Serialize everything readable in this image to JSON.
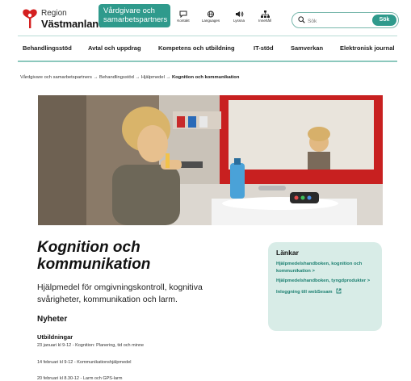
{
  "header": {
    "logo_region": "Region",
    "logo_name": "Västmanland",
    "partner_tag": "Vårdgivare och samarbetspartners",
    "icons": [
      {
        "name": "contact-icon",
        "label": "Kontakt"
      },
      {
        "name": "languages-icon",
        "label": "Languages"
      },
      {
        "name": "listen-icon",
        "label": "Lyssna"
      },
      {
        "name": "sitemap-icon",
        "label": "Innehåll"
      }
    ],
    "search": {
      "placeholder": "Sök",
      "button": "Sök"
    },
    "brand_color": "#2f9a8c"
  },
  "nav": {
    "items": [
      "Behandlingsstöd",
      "Avtal och uppdrag",
      "Kompetens och utbildning",
      "IT-stöd",
      "Samverkan",
      "Elektronisk journal"
    ]
  },
  "breadcrumb": {
    "items": [
      "Vårdgivare och samarbetspartners",
      "Behandlingsstöd",
      "Hjälpmedel"
    ],
    "separator": "→",
    "current": "Kognition och kommunikation"
  },
  "main": {
    "title": "Kognition och kommunikation",
    "intro": "Hjälpmedel för omgivningskontroll, kognitiva svårigheter, kommunikation och larm.",
    "news_heading": "Nyheter",
    "sub_heading": "Utbildningar",
    "news_items": [
      "23 januari kl 9-12 - Kognition: Planering, tid och minne",
      "14 februari kl 9-12 - Kommunikationshjälpmedel",
      "20 februari kl 8.30-12 - Larm och GPS-larm"
    ]
  },
  "links": {
    "title": "Länkar",
    "items": [
      "Hjälpmedelshandboken, kognition och kommunikation >",
      "Hjälpmedelshandboken, tyngdprodukter >",
      "Inloggning till webSesam"
    ],
    "external_icon": "external-link-icon"
  }
}
